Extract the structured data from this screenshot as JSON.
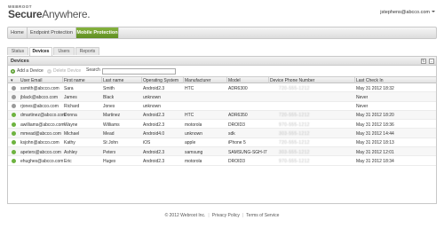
{
  "header": {
    "brand_small": "WEBROOT",
    "brand_big_part1": "Secure",
    "brand_big_part2": "Anywhere.",
    "user_email": "jstephens@abcco.com"
  },
  "topnav": {
    "tabs": [
      {
        "label": "Home",
        "active": false
      },
      {
        "label": "Endpoint Protection",
        "active": false
      },
      {
        "label": "Mobile Protection",
        "active": true
      }
    ]
  },
  "subtabs": [
    {
      "label": "Status",
      "active": false
    },
    {
      "label": "Devices",
      "active": true
    },
    {
      "label": "Users",
      "active": false
    },
    {
      "label": "Reports",
      "active": false
    }
  ],
  "panel": {
    "title": "Devices",
    "add_label": "Add a Device",
    "delete_label": "Delete Device",
    "search_label": "Search",
    "search_value": ""
  },
  "table": {
    "columns": [
      "User Email",
      "First name",
      "Last name",
      "Operating System",
      "Manufacturer",
      "Model",
      "Device Phone Number",
      "Last Check In"
    ],
    "rows": [
      {
        "status": "off",
        "email": "ssmith@abcco.com",
        "first": "Sara",
        "last": "Smith",
        "os": "Android2.3",
        "manufacturer": "HTC",
        "model": "ADR6300",
        "phone": "720-555-1212",
        "checkin": "May 31 2012 18:32"
      },
      {
        "status": "off",
        "email": "jblack@abcco.com",
        "first": "James",
        "last": "Black",
        "os": "unknown",
        "manufacturer": "",
        "model": "",
        "phone": "",
        "checkin": "Never"
      },
      {
        "status": "off",
        "email": "rjones@abcco.com",
        "first": "Richard",
        "last": "Jones",
        "os": "unknown",
        "manufacturer": "",
        "model": "",
        "phone": "",
        "checkin": "Never"
      },
      {
        "status": "on",
        "email": "dmartinez@abcco.com",
        "first": "Donna",
        "last": "Martinez",
        "os": "Android2.3",
        "manufacturer": "HTC",
        "model": "ADR6350",
        "phone": "720-555-1212",
        "checkin": "May 31 2012 18:20"
      },
      {
        "status": "on",
        "email": "awilliams@abcco.com",
        "first": "Wayne",
        "last": "Williams",
        "os": "Android2.3",
        "manufacturer": "motorola",
        "model": "DROID3",
        "phone": "970-555-1212",
        "checkin": "May 31 2012 18:36"
      },
      {
        "status": "on",
        "email": "mmead@abcco.com",
        "first": "Michael",
        "last": "Mead",
        "os": "Android4.0",
        "manufacturer": "unknown",
        "model": "sdk",
        "phone": "303-555-1212",
        "checkin": "May 31 2012 14:44"
      },
      {
        "status": "on",
        "email": "ksjohn@abcco.com",
        "first": "Kathy",
        "last": "St John",
        "os": "iOS",
        "manufacturer": "apple",
        "model": "iPhone 5",
        "phone": "720-555-1212",
        "checkin": "May 31 2012 18:13"
      },
      {
        "status": "on",
        "email": "apeters@abcco.com",
        "first": "Ashley",
        "last": "Peters",
        "os": "Android2.3",
        "manufacturer": "samsung",
        "model": "SAMSUNG-SGH-I7...",
        "phone": "303-555-1212",
        "checkin": "May 31 2012 12:01"
      },
      {
        "status": "on",
        "email": "ehughes@abcco.com",
        "first": "Eric",
        "last": "Huges",
        "os": "Android2.3",
        "manufacturer": "motorola",
        "model": "DROID3",
        "phone": "970-555-1212",
        "checkin": "May 31 2012 18:34"
      }
    ]
  },
  "footer": {
    "copyright": "© 2012 Webroot Inc.",
    "privacy": "Privacy Policy",
    "terms": "Terms of Service"
  }
}
